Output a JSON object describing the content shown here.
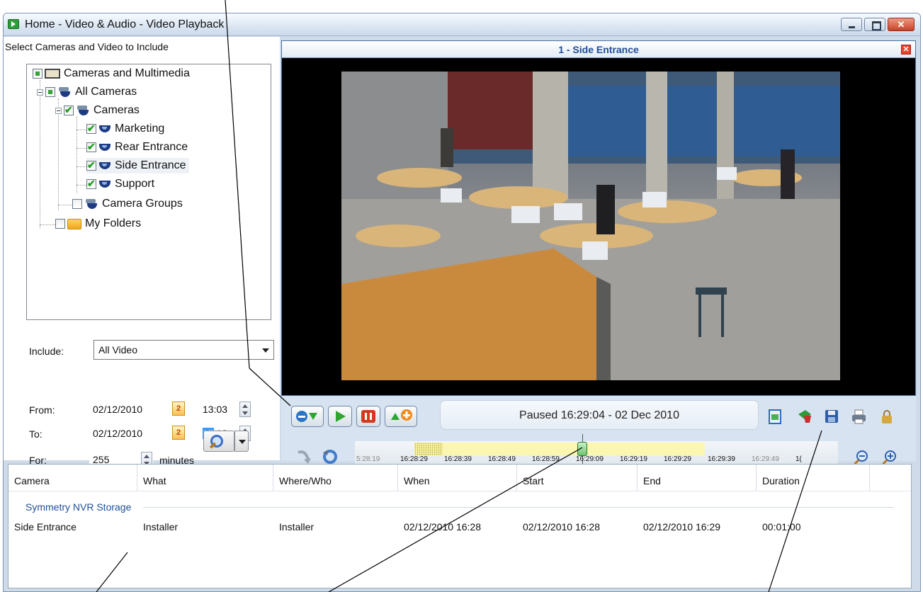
{
  "window": {
    "title": "Home - Video & Audio - Video Playback"
  },
  "left_panel": {
    "heading": "Select Cameras and Video to Include",
    "tree": [
      {
        "label": "Cameras and Multimedia"
      },
      {
        "label": "All Cameras"
      },
      {
        "label": "Cameras"
      },
      {
        "label": "Marketing"
      },
      {
        "label": "Rear Entrance"
      },
      {
        "label": "Side Entrance"
      },
      {
        "label": "Support"
      },
      {
        "label": "Camera Groups"
      },
      {
        "label": "My Folders"
      }
    ],
    "include_label": "Include:",
    "include_value": "All Video",
    "from_label": "From:",
    "from_date": "02/12/2010",
    "from_time": "13:03",
    "to_label": "To:",
    "to_date": "02/12/2010",
    "to_time_hour": "17",
    "to_time_rest": ":18",
    "for_label": "For:",
    "for_value": "255",
    "minutes_label": "minutes",
    "calendar_glyph": "2"
  },
  "video": {
    "title": "1 - Side Entrance",
    "status": "Paused 16:29:04 - 02 Dec 2010"
  },
  "timeline": {
    "ticks": [
      "5:28:19",
      "16:28:29",
      "16:28:39",
      "16:28:49",
      "16:28:59",
      "16:29:09",
      "16:29:19",
      "16:29:29",
      "16:29:39",
      "16:29:49",
      "1("
    ],
    "position_fraction": 0.47
  },
  "list": {
    "columns": [
      "Camera",
      "What",
      "Where/Who",
      "When",
      "Start",
      "End",
      "Duration"
    ],
    "group": "Symmetry NVR Storage",
    "rows": [
      [
        "Side Entrance",
        "Installer",
        "Installer",
        "02/12/2010 16:28",
        "02/12/2010 16:28",
        "02/12/2010 16:29",
        "00:01:00"
      ]
    ]
  },
  "colors": {
    "accent": "#1f4e98",
    "frame": "#4a6fa0",
    "play": "#2fa52f",
    "pause": "#d23a1f"
  }
}
